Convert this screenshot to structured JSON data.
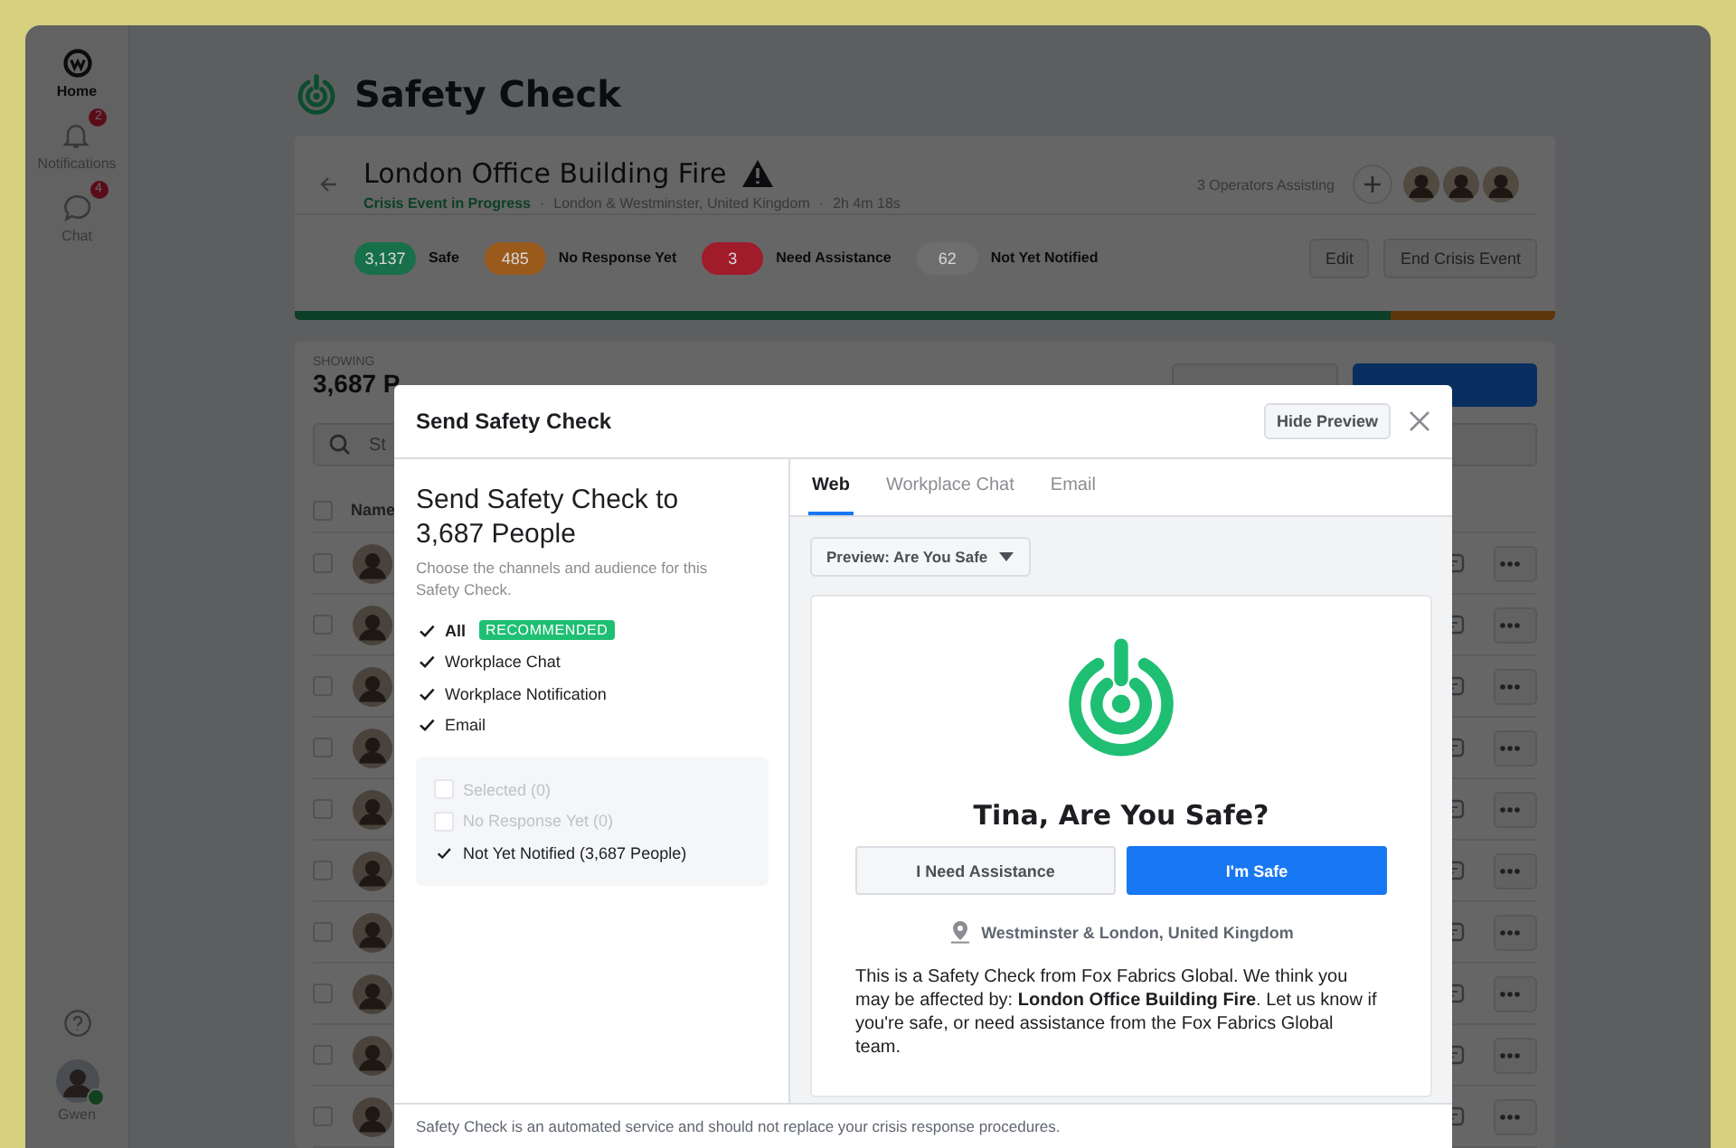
{
  "sidebar": {
    "items": [
      {
        "label": "Home",
        "selected": true
      },
      {
        "label": "Notifications",
        "badge": "2",
        "selected": false
      },
      {
        "label": "Chat",
        "badge": "4",
        "selected": false
      }
    ],
    "user": {
      "name": "Gwen",
      "online": true
    }
  },
  "page": {
    "title": "Safety Check"
  },
  "crisis": {
    "title": "London Office Building Fire",
    "meta": [
      {
        "text": "Crisis Event in Progress",
        "kind": "status"
      },
      {
        "text": "·",
        "kind": "separator"
      },
      {
        "text": "London & Westminster, United Kingdom",
        "kind": "detail"
      },
      {
        "text": "·",
        "kind": "separator"
      },
      {
        "text": "2h 4m 18s",
        "kind": "detail"
      }
    ],
    "operators": "3 Operators Assisting",
    "stats": [
      {
        "count": "3,137",
        "label": "Safe",
        "color": "#17704a"
      },
      {
        "count": "485",
        "label": "No Response Yet",
        "color": "#9a5a1c"
      },
      {
        "count": "3",
        "label": "Need Assistance",
        "color": "#a01c2a"
      },
      {
        "count": "62",
        "label": "Not Yet Notified",
        "color": "#6e6e6e"
      }
    ],
    "actions": [
      "Edit",
      "End Crisis Event"
    ],
    "progress": {
      "level": 0.87
    }
  },
  "list": {
    "showing_label": "SHOWING",
    "count": "3,687 P",
    "search_placeholder": "St",
    "select_all_checked": false,
    "columns": [
      "Name"
    ],
    "rows": [
      {
        "checked": false
      },
      {
        "checked": false
      },
      {
        "checked": false
      },
      {
        "checked": false
      },
      {
        "checked": false
      },
      {
        "checked": false
      },
      {
        "checked": false
      },
      {
        "checked": false
      },
      {
        "checked": false
      },
      {
        "checked": false
      }
    ]
  },
  "modal": {
    "title": "Send Safety Check",
    "hide_preview": "Hide Preview",
    "heading": "Send Safety Check to 3,687 People",
    "description": "Choose the channels and audience for this Safety Check.",
    "channels": [
      {
        "label": "All",
        "checked": true,
        "badge": "RECOMMENDED"
      },
      {
        "label": "Workplace Chat",
        "checked": true
      },
      {
        "label": "Workplace Notification",
        "checked": true
      },
      {
        "label": "Email",
        "checked": true
      }
    ],
    "audience": [
      {
        "label": "Selected (0)",
        "checked": false,
        "disabled": true
      },
      {
        "label": "No Response Yet (0)",
        "checked": false,
        "disabled": true
      },
      {
        "label": "Not Yet Notified (3,687 People)",
        "checked": true,
        "disabled": false
      }
    ],
    "tabs": [
      {
        "label": "Web",
        "selected": true
      },
      {
        "label": "Workplace Chat",
        "selected": false
      },
      {
        "label": "Email",
        "selected": false
      }
    ],
    "preview_select": "Preview: Are You Safe",
    "preview": {
      "question": "Tina, Are You Safe?",
      "buttons": [
        {
          "label": "I Need Assistance",
          "kind": "secondary"
        },
        {
          "label": "I'm Safe",
          "kind": "primary"
        }
      ],
      "location": "Westminster & London, United Kingdom",
      "message": "This is a Safety Check from Fox Fabrics Global. We think you may be affected by: **London Office Building Fire**. Let us know if you're safe, or need assistance from the Fox Fabrics Global team."
    },
    "footer": "Safety Check is an automated service and should not replace your crisis response procedures."
  }
}
